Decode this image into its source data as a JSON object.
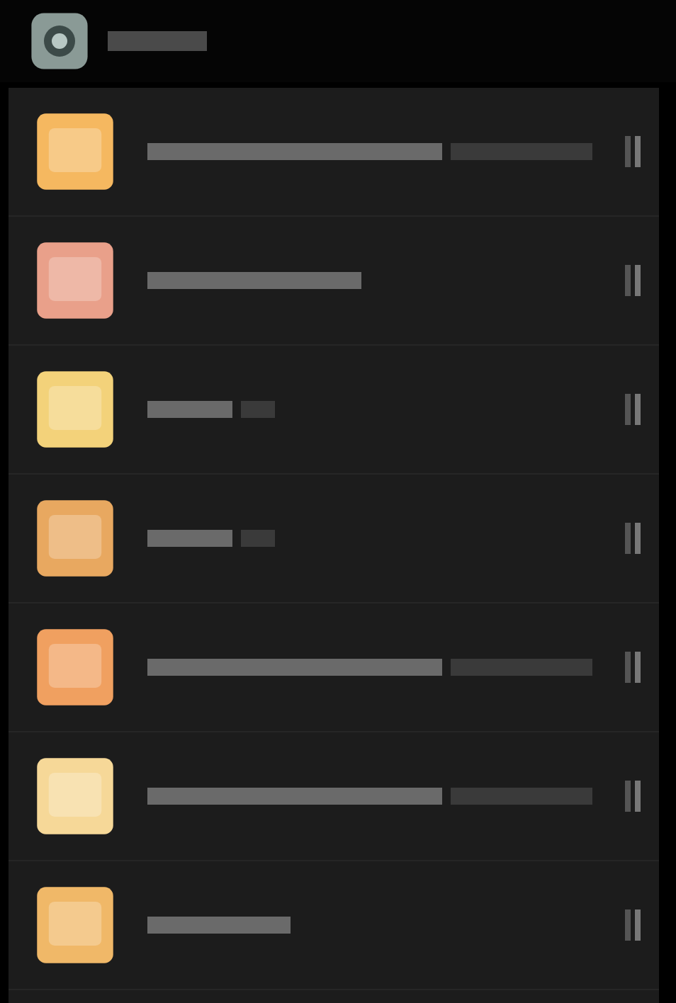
{
  "app_bar": {
    "kind": "title-bar"
  },
  "rows": [
    {
      "kind": "long",
      "color": "#f5b860"
    },
    {
      "kind": "medium",
      "color": "#e9a08a"
    },
    {
      "kind": "short",
      "color": "#f3d27a"
    },
    {
      "kind": "short",
      "color": "#e8a860"
    },
    {
      "kind": "long",
      "color": "#f0a060"
    },
    {
      "kind": "long",
      "color": "#f6d898"
    },
    {
      "kind": "bare",
      "color": "#f0b868"
    }
  ]
}
